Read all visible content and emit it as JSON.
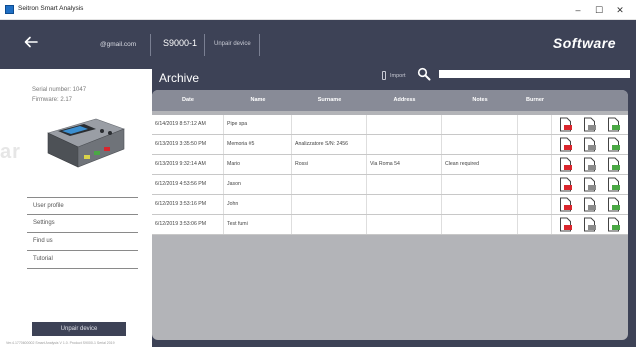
{
  "window": {
    "title": "Seitron Smart Analysis",
    "minimize": "–",
    "maximize": "☐",
    "close": "✕"
  },
  "header": {
    "email": "@gmail.com",
    "device": "S9000-1",
    "unpair": "Unpair device",
    "brand": "Software"
  },
  "sidebar": {
    "serial": "Serial number: 1047",
    "firmware": "Firmware: 2.17",
    "watermark": "ar",
    "menu": [
      "User profile",
      "Settings",
      "Find us",
      "Tutorial"
    ],
    "unpair_button": "Unpair device",
    "footer": "Ver.4.1770600002    Smart Analysis V 1.0.  Product S9000-1  Serial 2019"
  },
  "archive": {
    "title": "Archive",
    "import_label": "Import",
    "search_placeholder": "",
    "columns": [
      "Date",
      "Name",
      "Surname",
      "Address",
      "Notes",
      "Burner"
    ],
    "rows": [
      {
        "date": "6/14/2019 8:57:12 AM",
        "name": "Pipe spa",
        "surname": "",
        "address": "",
        "notes": "",
        "burner": ""
      },
      {
        "date": "6/13/2019 3:35:50 PM",
        "name": "Memoria #5",
        "surname": "Analizzatore S/N: 2456",
        "address": "",
        "notes": "",
        "burner": ""
      },
      {
        "date": "6/13/2019 9:32:14 AM",
        "name": "Mario",
        "surname": "Rossi",
        "address": "Via Roma 54",
        "notes": "Clean required",
        "burner": ""
      },
      {
        "date": "6/12/2019 4:53:56 PM",
        "name": "Jason",
        "surname": "",
        "address": "",
        "notes": "",
        "burner": ""
      },
      {
        "date": "6/12/2019 3:53:16 PM",
        "name": "John",
        "surname": "",
        "address": "",
        "notes": "",
        "burner": ""
      },
      {
        "date": "6/12/2019 3:53:06 PM",
        "name": "Test fumi",
        "surname": "",
        "address": "",
        "notes": "",
        "burner": ""
      }
    ]
  },
  "icons": {
    "back": "arrow-left-icon",
    "search": "search-icon",
    "import": "phone-icon",
    "row_actions": [
      "delete-document-icon",
      "view-document-icon",
      "export-document-icon"
    ]
  },
  "colors": {
    "header": "#3d4256",
    "table_header": "#888b97",
    "panel": "#b3b4b8",
    "delete": "#d9262d",
    "view": "#8a8a8a",
    "export": "#4aa845"
  }
}
